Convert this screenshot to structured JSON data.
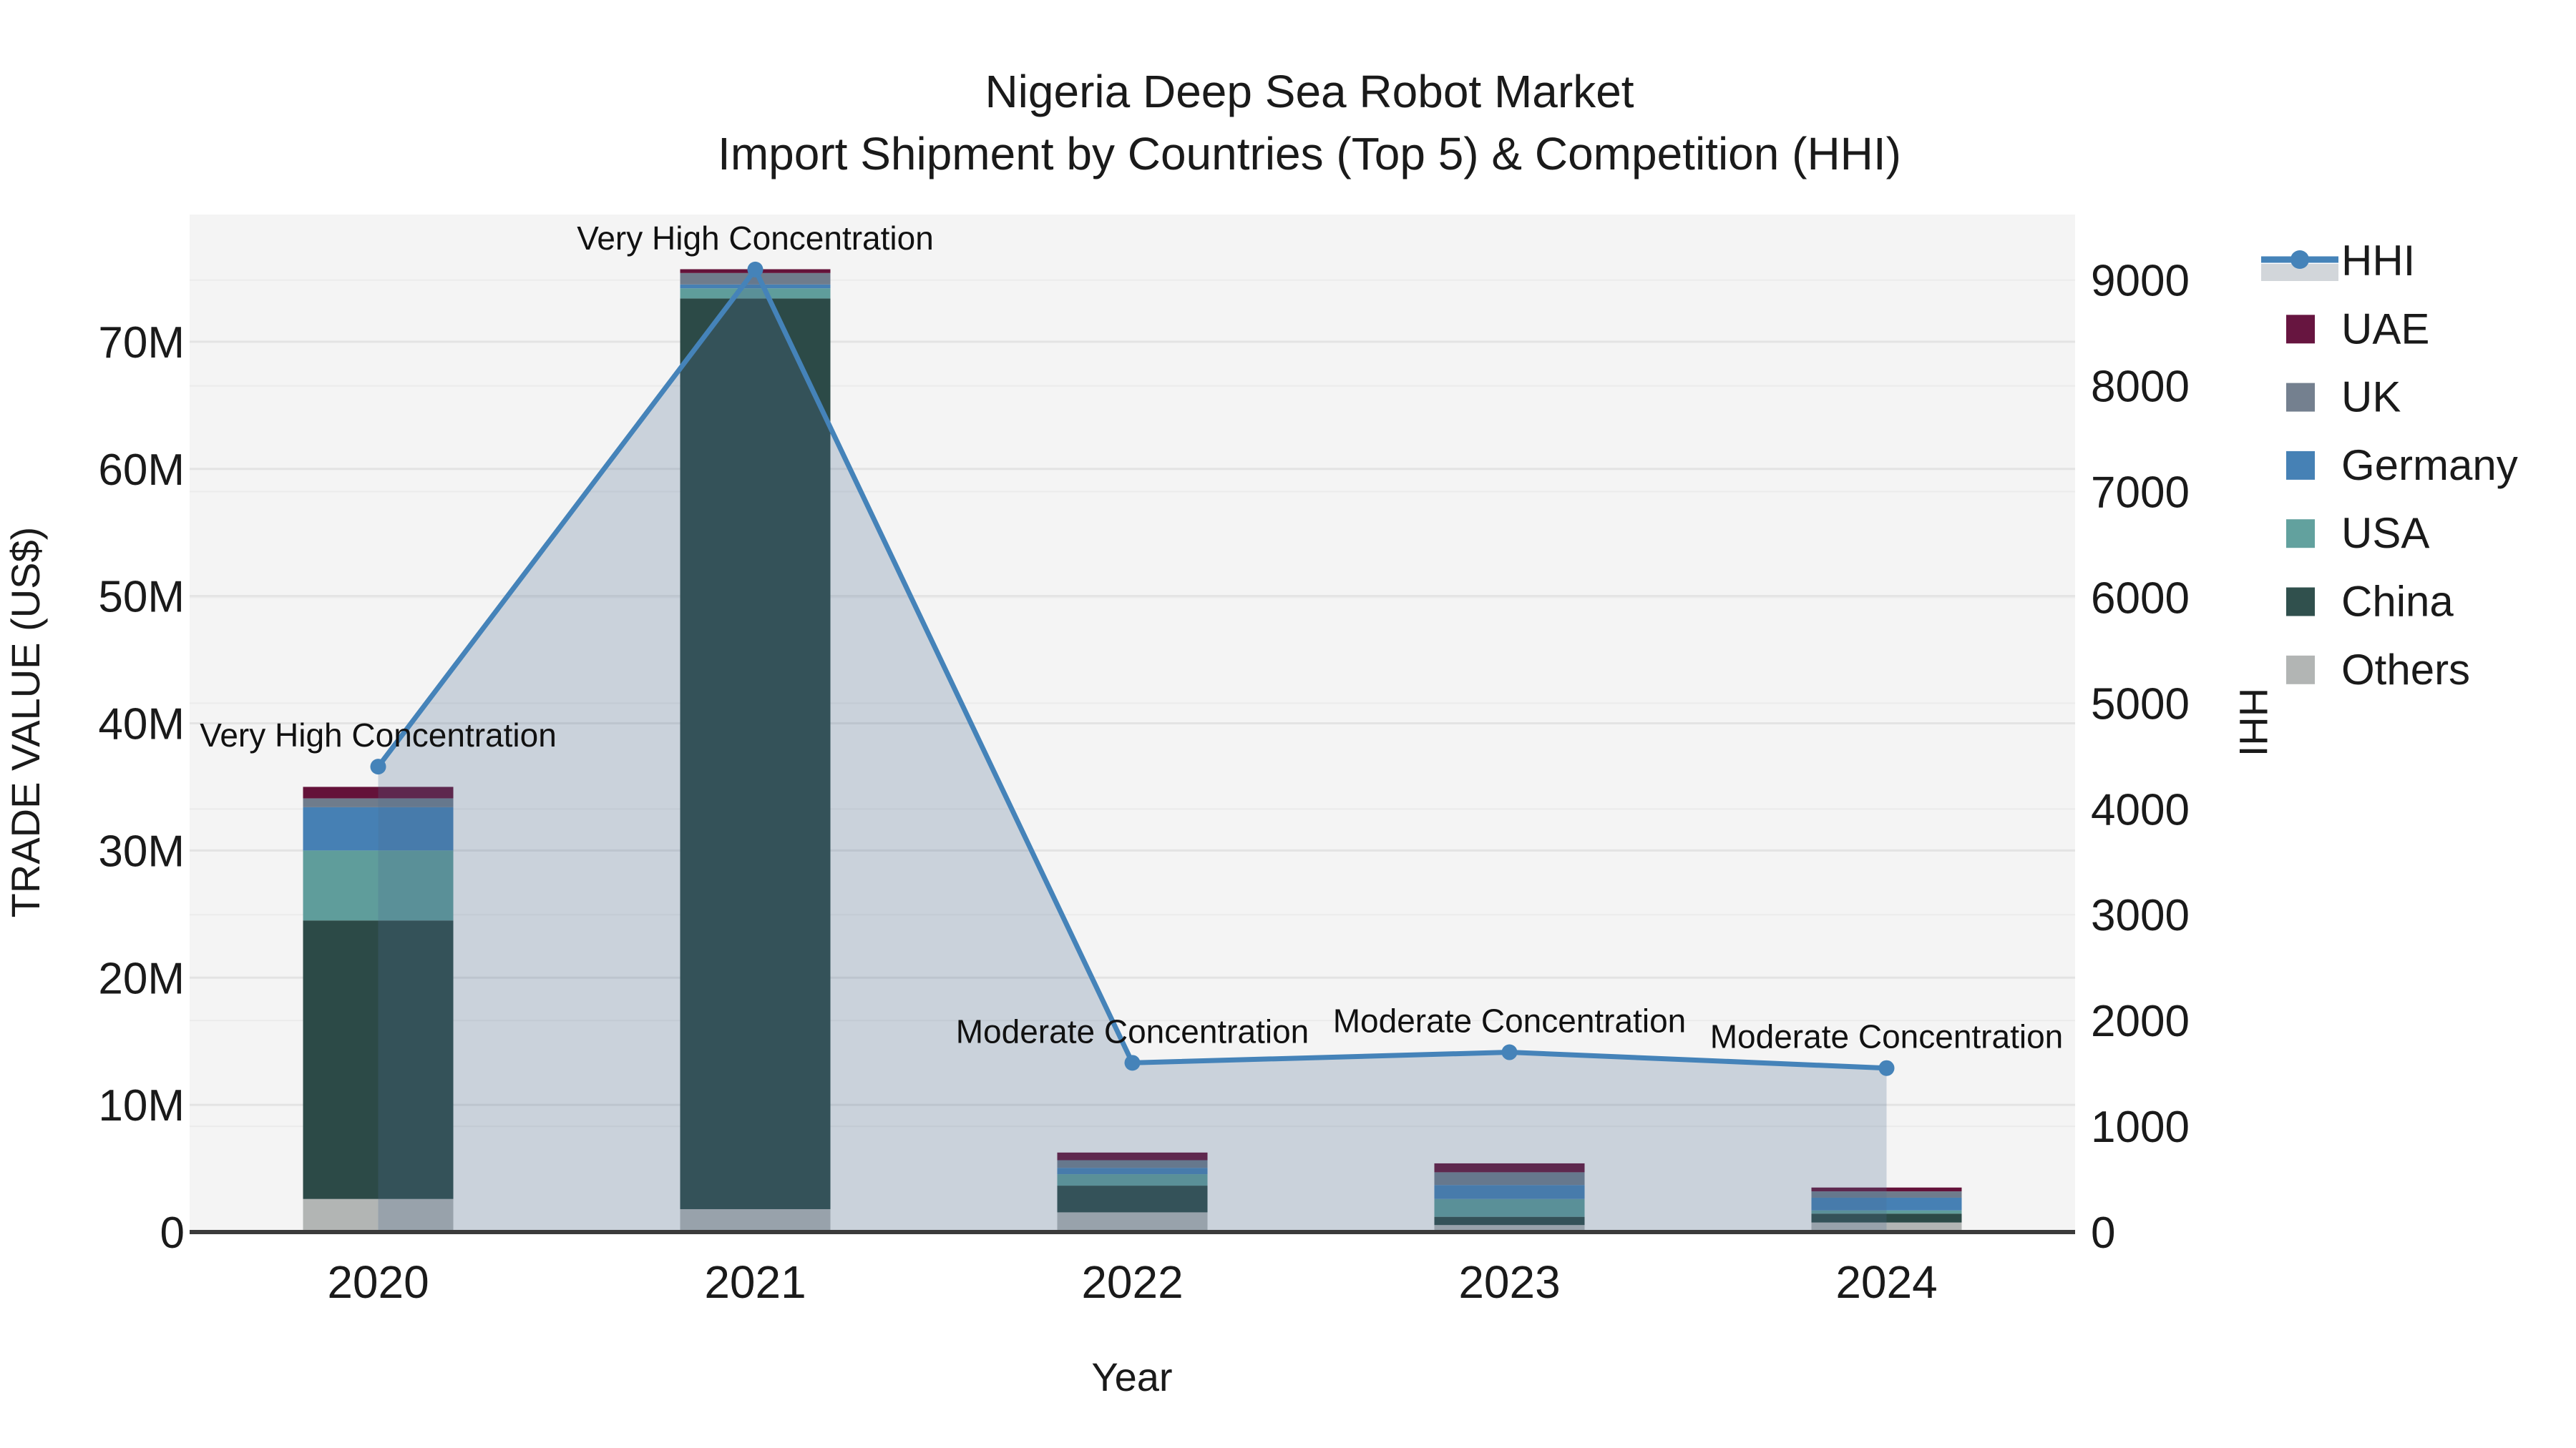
{
  "title": {
    "line1": "Nigeria Deep Sea Robot Market",
    "line2": "Import Shipment by Countries (Top 5) & Competition (HHI)"
  },
  "axes": {
    "left": {
      "title": "TRADE VALUE (US$)",
      "tick_labels": [
        "0",
        "10M",
        "20M",
        "30M",
        "40M",
        "50M",
        "60M",
        "70M"
      ],
      "tick_values": [
        0,
        10,
        20,
        30,
        40,
        50,
        60,
        70
      ],
      "max": 80
    },
    "right": {
      "title": "HHI",
      "tick_labels": [
        "0",
        "1000",
        "2000",
        "3000",
        "4000",
        "5000",
        "6000",
        "7000",
        "8000",
        "9000"
      ],
      "tick_values": [
        0,
        1000,
        2000,
        3000,
        4000,
        5000,
        6000,
        7000,
        8000,
        9000
      ],
      "max": 9620
    },
    "x": {
      "title": "Year",
      "categories": [
        "2020",
        "2021",
        "2022",
        "2023",
        "2024"
      ]
    }
  },
  "legend": {
    "items": [
      {
        "label": "HHI",
        "type": "line",
        "color": "#4583b9",
        "fill": "#d2d6da"
      },
      {
        "label": "UAE",
        "type": "swatch",
        "color": "#671540"
      },
      {
        "label": "UK",
        "type": "swatch",
        "color": "#74808f"
      },
      {
        "label": "Germany",
        "type": "swatch",
        "color": "#4681b5"
      },
      {
        "label": "USA",
        "type": "swatch",
        "color": "#62a19e"
      },
      {
        "label": "China",
        "type": "swatch",
        "color": "#30504d"
      },
      {
        "label": "Others",
        "type": "swatch",
        "color": "#b2b5b4"
      }
    ]
  },
  "chart_data": {
    "type": "combo-stacked-bar-line",
    "title": "Nigeria Deep Sea Robot Market — Import Shipment by Countries (Top 5) & Competition (HHI)",
    "categories": [
      "2020",
      "2021",
      "2022",
      "2023",
      "2024"
    ],
    "bar_value_unit": "million US$",
    "bar_series": [
      {
        "name": "Others",
        "color": "#b2b5b4",
        "values": [
          2.6,
          1.8,
          1.55,
          0.55,
          0.75
        ]
      },
      {
        "name": "China",
        "color": "#2c4a47",
        "values": [
          21.9,
          71.6,
          2.1,
          0.65,
          0.7
        ]
      },
      {
        "name": "USA",
        "color": "#5f9d9b",
        "values": [
          5.5,
          0.8,
          0.9,
          1.4,
          0.25
        ]
      },
      {
        "name": "Germany",
        "color": "#4680b4",
        "values": [
          3.4,
          0.3,
          0.5,
          1.1,
          1.0
        ]
      },
      {
        "name": "UK",
        "color": "#6f7c8c",
        "values": [
          0.7,
          0.9,
          0.6,
          1.0,
          0.5
        ]
      },
      {
        "name": "UAE",
        "color": "#641239",
        "values": [
          0.9,
          0.3,
          0.6,
          0.7,
          0.3
        ]
      }
    ],
    "bar_totals": [
      35.0,
      75.7,
      6.25,
      5.4,
      3.5
    ],
    "line_series": {
      "name": "HHI",
      "color": "#4583b9",
      "area_fill": "rgba(74,106,142,0.25)",
      "values": [
        4400,
        9100,
        1600,
        1700,
        1550
      ]
    },
    "annotations": [
      "Very High Concentration",
      "Very High Concentration",
      "Moderate Concentration",
      "Moderate Concentration",
      "Moderate Concentration"
    ],
    "xlabel": "Year",
    "ylabel_left": "TRADE VALUE (US$)",
    "ylabel_right": "HHI",
    "ylim_left": [
      0,
      80
    ],
    "ylim_right": [
      0,
      9620
    ],
    "grid": true,
    "legend_position": "right"
  },
  "colors": {
    "plot_bg": "#f4f4f4",
    "grid_major": "#e3e3e3",
    "grid_minor": "#ebebeb",
    "axis_line": "#3b3b3b",
    "text": "#1a1a1a"
  }
}
